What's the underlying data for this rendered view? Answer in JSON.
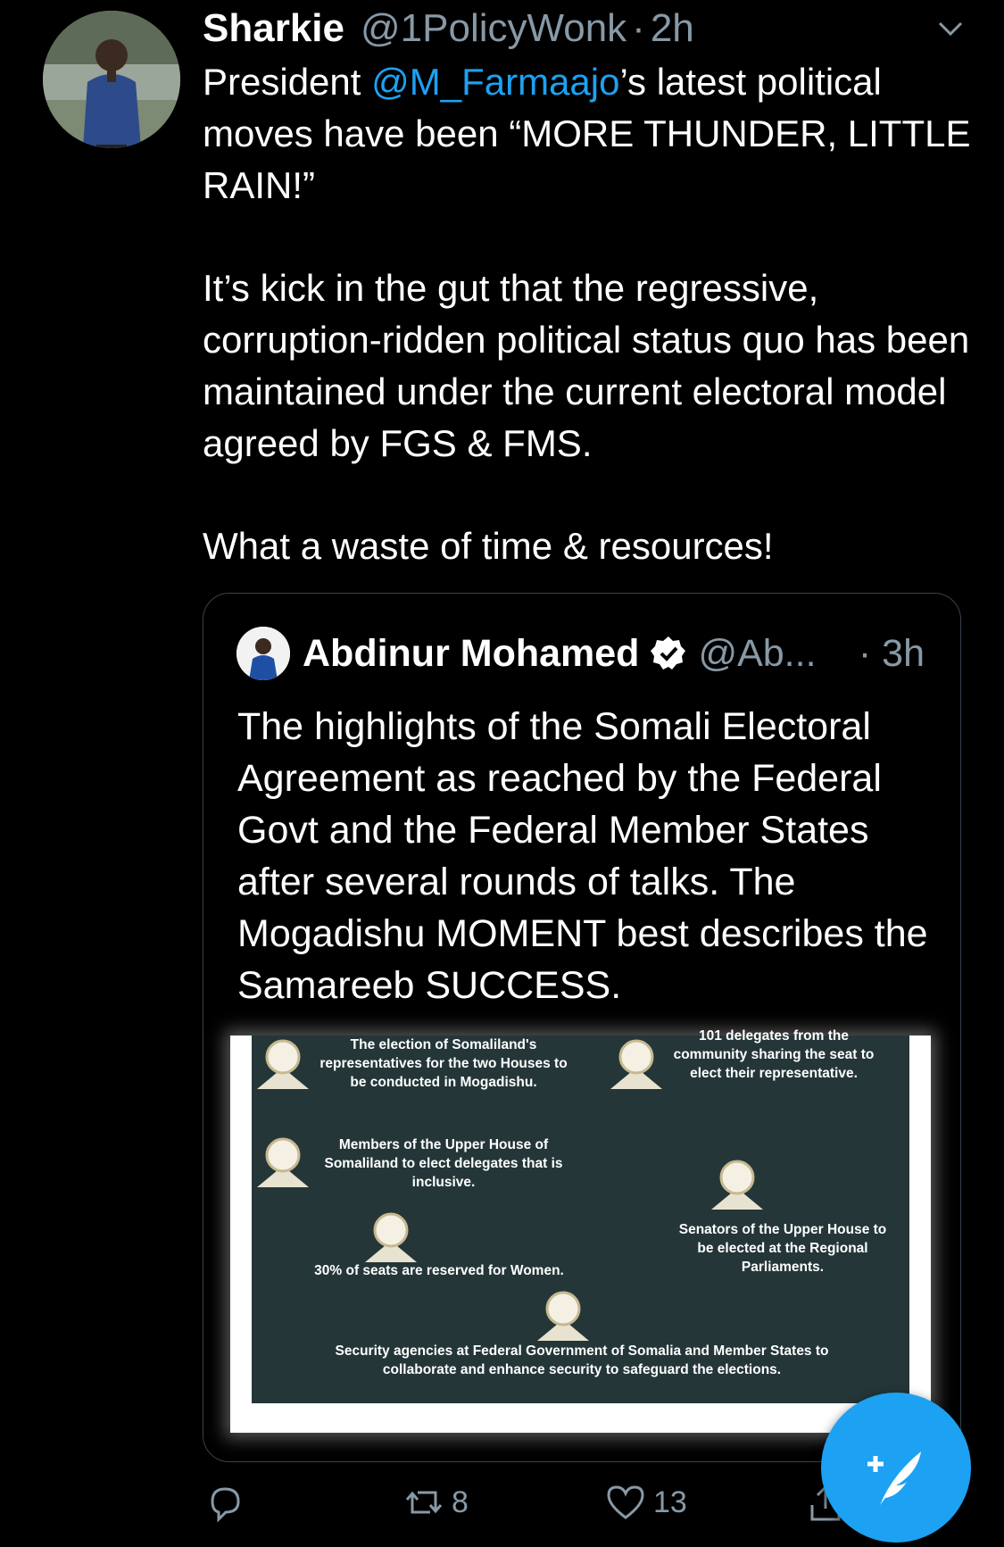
{
  "tweet": {
    "author_name": "Sharkie",
    "author_handle": "@1PolicyWonk",
    "separator": "·",
    "time": "2h",
    "text_p1_before": "President ",
    "text_p1_mention": "@M_Farmaajo",
    "text_p1_after": "’s latest political moves have been “MORE THUNDER, LITTLE RAIN!”",
    "text_p2": "It’s kick in the gut that the regressive, corruption-ridden political status quo has been maintained under the current electoral model agreed by FGS & FMS.",
    "text_p3": "What a waste of time & resources!"
  },
  "quote": {
    "author_name": "Abdinur Mohamed",
    "author_handle": "@Ab...",
    "separator": "·",
    "time": "3h",
    "text": "The highlights of the Somali Electoral Agreement as reached by the Federal Govt and the Federal Member States after several rounds of talks. The Mogadishu MOMENT best describes the Samareeb SUCCESS.",
    "infographic": {
      "item1": "The election of Somaliland's representatives for the two Houses to be conducted  in Mogadishu.",
      "item2": "101 delegates from the community sharing the seat to elect their representative.",
      "item3": "Members of the Upper House of Somaliland to elect delegates that is inclusive.",
      "item4": "Senators of the Upper House to be elected at the Regional Parliaments.",
      "item5": "30%  of seats are reserved for Women.",
      "item6": "Security agencies at Federal Government of Somalia and Member States to collaborate and enhance security  to safeguard the elections."
    }
  },
  "actions": {
    "retweets": "8",
    "likes": "13"
  },
  "icons": {
    "reply": "reply-icon",
    "retweet": "retweet-icon",
    "like": "heart-icon",
    "share": "share-icon",
    "compose": "compose-icon",
    "caret": "chevron-down-icon",
    "verified": "verified-badge-icon"
  },
  "colors": {
    "background": "#000000",
    "accent": "#1da1f2",
    "muted": "#8899a6",
    "infographic_bg": "#243638"
  }
}
